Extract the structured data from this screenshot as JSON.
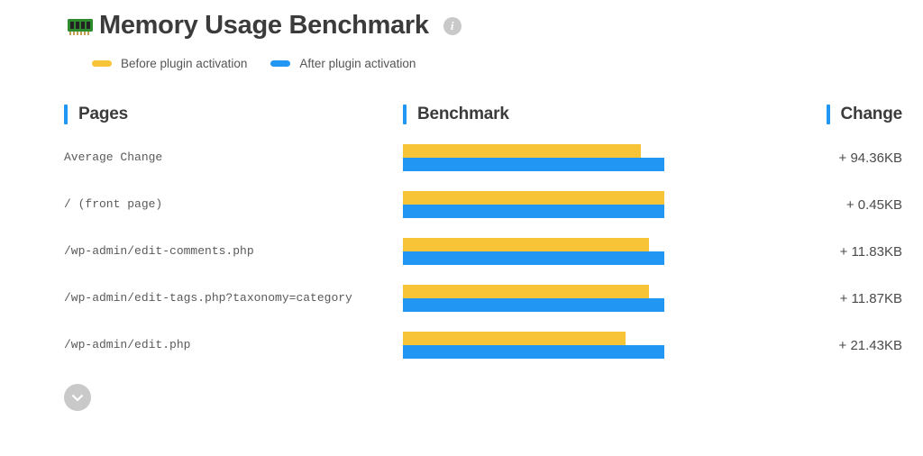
{
  "header": {
    "title": "Memory Usage Benchmark"
  },
  "legend": {
    "before": "Before plugin activation",
    "after": "After plugin activation"
  },
  "colors": {
    "before": "#f6c436",
    "after": "#2196f3"
  },
  "columns": {
    "pages": "Pages",
    "benchmark": "Benchmark",
    "change": "Change"
  },
  "rows": [
    {
      "page": "Average Change",
      "before_pct": 91,
      "after_pct": 100,
      "change": "+ 94.36KB"
    },
    {
      "page": "/ (front page)",
      "before_pct": 100,
      "after_pct": 100,
      "change": "+ 0.45KB"
    },
    {
      "page": "/wp-admin/edit-comments.php",
      "before_pct": 94,
      "after_pct": 100,
      "change": "+ 11.83KB"
    },
    {
      "page": "/wp-admin/edit-tags.php?taxonomy=category",
      "before_pct": 94,
      "after_pct": 100,
      "change": "+ 11.87KB"
    },
    {
      "page": "/wp-admin/edit.php",
      "before_pct": 85,
      "after_pct": 100,
      "change": "+ 21.43KB"
    }
  ],
  "chart_data": {
    "type": "bar",
    "title": "Memory Usage Benchmark",
    "xlabel": "",
    "ylabel": "",
    "categories": [
      "Average Change",
      "/ (front page)",
      "/wp-admin/edit-comments.php",
      "/wp-admin/edit-tags.php?taxonomy=category",
      "/wp-admin/edit.php"
    ],
    "series": [
      {
        "name": "Before plugin activation",
        "values": [
          91,
          100,
          94,
          94,
          85
        ]
      },
      {
        "name": "After plugin activation",
        "values": [
          100,
          100,
          100,
          100,
          100
        ]
      }
    ],
    "change_labels": [
      "+ 94.36KB",
      "+ 0.45KB",
      "+ 11.83KB",
      "+ 11.87KB",
      "+ 21.43KB"
    ],
    "legend_position": "top",
    "grid": false
  }
}
